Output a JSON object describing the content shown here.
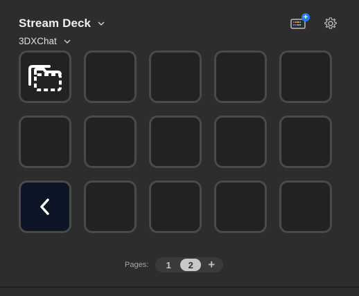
{
  "header": {
    "device_title": "Stream Deck",
    "profile_name": "3DXChat",
    "add_store_badge": "+",
    "icons": {
      "device_dropdown": "chevron-down-icon",
      "profile_dropdown": "chevron-down-icon",
      "store": "keypad-plus-icon",
      "settings": "gear-icon"
    }
  },
  "grid": {
    "rows": 3,
    "columns": 5,
    "keys": [
      {
        "icon": "folder-stack-icon"
      },
      {
        "icon": ""
      },
      {
        "icon": ""
      },
      {
        "icon": ""
      },
      {
        "icon": ""
      },
      {
        "icon": ""
      },
      {
        "icon": ""
      },
      {
        "icon": ""
      },
      {
        "icon": ""
      },
      {
        "icon": ""
      },
      {
        "icon": "chevron-left-icon"
      },
      {
        "icon": ""
      },
      {
        "icon": ""
      },
      {
        "icon": ""
      },
      {
        "icon": ""
      }
    ]
  },
  "pager": {
    "label": "Pages:",
    "pages": [
      "1",
      "2"
    ],
    "active_page": "2",
    "add_label": "+"
  },
  "colors": {
    "background": "#2d2d2d",
    "key_fill": "#222222",
    "key_border": "#4a4a4a",
    "back_key_fill": "#0d1626",
    "badge": "#1f7cf0"
  }
}
